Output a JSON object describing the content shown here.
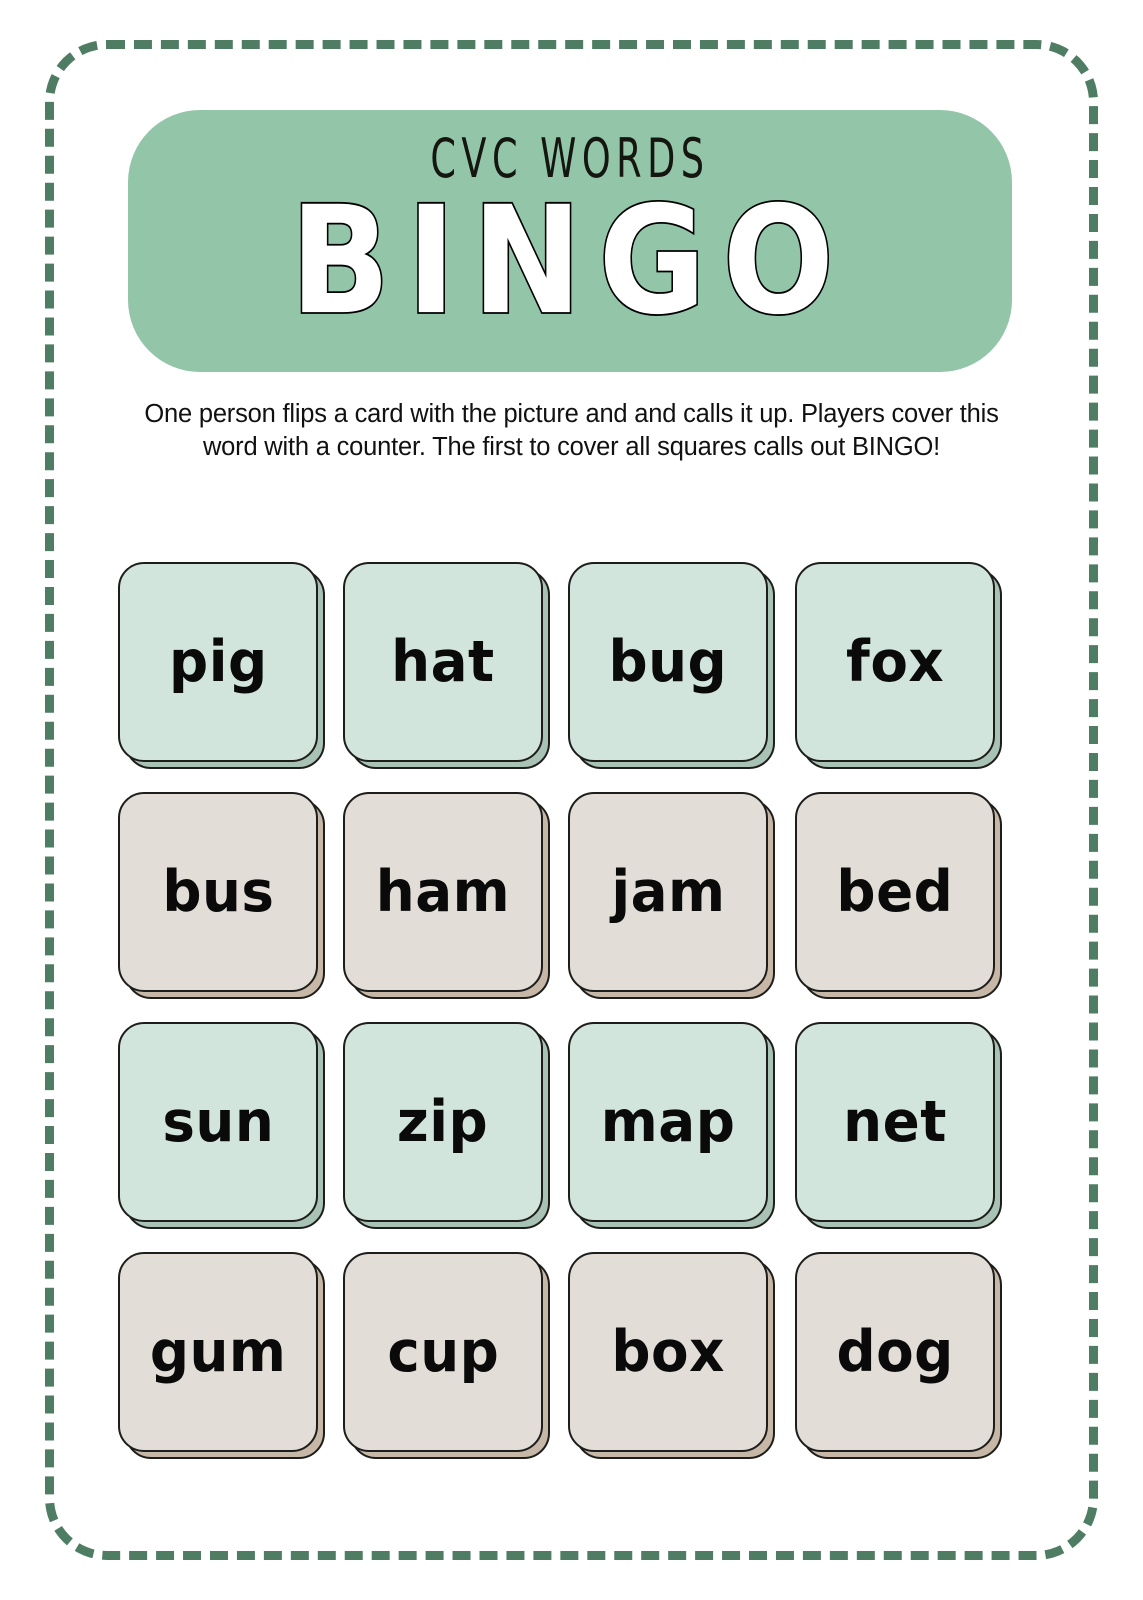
{
  "page": {
    "background_color": "#ffffff",
    "border_color": "#4f7d64",
    "border_style": "dashed"
  },
  "header": {
    "kicker": "CVC WORDS",
    "title": "BINGO",
    "banner_color": "#93c5a9",
    "title_color": "#ffffff",
    "title_outline_color": "#000000"
  },
  "instructions": {
    "text": "One person flips a card with the picture and and calls it up. Players cover this word with a counter. The first to cover all squares calls out BINGO!"
  },
  "grid": {
    "columns": 4,
    "rows": 4,
    "mint_color": "#d2e5dc",
    "mint_shadow_color": "#a9c2b6",
    "beige_color": "#e2ddd6",
    "beige_shadow_color": "#c6b7a6",
    "tiles": [
      {
        "word": "pig",
        "variant": "mint"
      },
      {
        "word": "hat",
        "variant": "mint"
      },
      {
        "word": "bug",
        "variant": "mint"
      },
      {
        "word": "fox",
        "variant": "mint"
      },
      {
        "word": "bus",
        "variant": "beige"
      },
      {
        "word": "ham",
        "variant": "beige"
      },
      {
        "word": "jam",
        "variant": "beige"
      },
      {
        "word": "bed",
        "variant": "beige"
      },
      {
        "word": "sun",
        "variant": "mint"
      },
      {
        "word": "zip",
        "variant": "mint"
      },
      {
        "word": "map",
        "variant": "mint"
      },
      {
        "word": "net",
        "variant": "mint"
      },
      {
        "word": "gum",
        "variant": "beige"
      },
      {
        "word": "cup",
        "variant": "beige"
      },
      {
        "word": "box",
        "variant": "beige"
      },
      {
        "word": "dog",
        "variant": "beige"
      }
    ]
  }
}
